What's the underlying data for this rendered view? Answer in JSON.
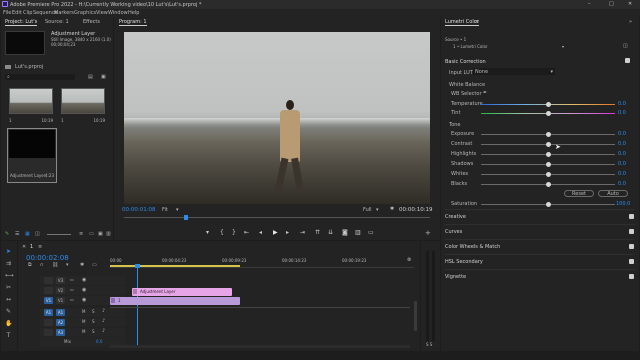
{
  "app": {
    "title": "Adobe Premiere Pro 2022 - H:\\Currently Working video\\10 Lut's\\Lut's.prproj *",
    "window_buttons": [
      "–",
      "□",
      "✕"
    ]
  },
  "menu": [
    "File",
    "Edit",
    "Clip",
    "Sequence",
    "Markers",
    "Graphics",
    "View",
    "Window",
    "Help"
  ],
  "project_panel": {
    "tabs": [
      "Project: Lut's",
      "Source: 1",
      "Effects"
    ],
    "item_name": "Adjustment Layer",
    "item_info": "Still Image, 3840 x 2160 (1.0)",
    "item_duration": "00;00;04;23",
    "project_file": "Lut's.prproj",
    "clips": [
      {
        "name": "1",
        "duration": "10:19"
      },
      {
        "name": "1",
        "duration": "10:19"
      },
      {
        "name": "Adjustment Layer",
        "duration": "4:23"
      }
    ]
  },
  "program_monitor": {
    "tab": "Program: 1",
    "timecode": "00:00:01:08",
    "fit": "Fit",
    "quality": "Full",
    "duration": "00:00:10:19"
  },
  "lumetri": {
    "tab": "Lumetri Color",
    "source": "Source • 1",
    "clip": "1 • Lumetri Color",
    "basic_correction": "Basic Correction",
    "input_lut_label": "Input LUT",
    "input_lut_value": "None",
    "white_balance": "White Balance",
    "wb_selector": "WB Selector",
    "tone": "Tone",
    "sliders": [
      {
        "label": "Temperature",
        "value": "0.0",
        "pos": 0.5
      },
      {
        "label": "Tint",
        "value": "0.0",
        "pos": 0.5
      },
      {
        "label": "Exposure",
        "value": "0.0",
        "pos": 0.5
      },
      {
        "label": "Contrast",
        "value": "0.0",
        "pos": 0.5
      },
      {
        "label": "Highlights",
        "value": "0.0",
        "pos": 0.5
      },
      {
        "label": "Shadows",
        "value": "0.0",
        "pos": 0.5
      },
      {
        "label": "Whites",
        "value": "0.0",
        "pos": 0.5
      },
      {
        "label": "Blacks",
        "value": "0.0",
        "pos": 0.5
      }
    ],
    "reset": "Reset",
    "auto": "Auto",
    "saturation_label": "Saturation",
    "saturation_value": "100.0",
    "sections": [
      "Creative",
      "Curves",
      "Color Wheels & Match",
      "HSL Secondary",
      "Vignette"
    ]
  },
  "timeline": {
    "tab": "1",
    "timecode": "00:00:02:08",
    "ruler": [
      "00:00",
      "00:00:04:23",
      "00:00:09:23",
      "00:00:14:23",
      "00:00:19:23"
    ],
    "tracks": [
      "V3",
      "V2",
      "V1",
      "A1",
      "A2",
      "A3"
    ],
    "source_labels": [
      "V1",
      "A1"
    ],
    "mix_label": "Mix",
    "mix_value": "0.0",
    "clip_adjust": "Adjustment Layer",
    "clip_video": "1"
  },
  "colors": {
    "accent": "#2d8ceb",
    "adjust_clip": "#e6a5e6",
    "video_clip": "#b89ad8"
  }
}
